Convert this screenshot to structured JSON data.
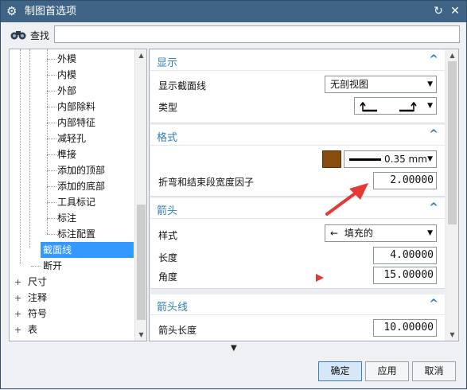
{
  "window": {
    "title": "制图首选项",
    "reset_icon": "reset-icon",
    "close_icon": "close-icon"
  },
  "search": {
    "label": "查找",
    "value": ""
  },
  "tree": {
    "items": [
      {
        "label": "外模",
        "level": 2
      },
      {
        "label": "内模",
        "level": 2
      },
      {
        "label": "外部",
        "level": 2
      },
      {
        "label": "内部除料",
        "level": 2
      },
      {
        "label": "内部特征",
        "level": 2
      },
      {
        "label": "减轻孔",
        "level": 2
      },
      {
        "label": "榫接",
        "level": 2
      },
      {
        "label": "添加的顶部",
        "level": 2
      },
      {
        "label": "添加的底部",
        "level": 2
      },
      {
        "label": "工具标记",
        "level": 2
      },
      {
        "label": "标注",
        "level": 2
      },
      {
        "label": "标注配置",
        "level": 2
      },
      {
        "label": "截面线",
        "level": 1,
        "selected": true
      },
      {
        "label": "断开",
        "level": 1
      },
      {
        "label": "尺寸",
        "level": 0,
        "expandable": true
      },
      {
        "label": "注释",
        "level": 0,
        "expandable": true
      },
      {
        "label": "符号",
        "level": 0,
        "expandable": true
      },
      {
        "label": "表",
        "level": 0,
        "expandable": true
      }
    ]
  },
  "display_section": {
    "title": "显示",
    "show_section_line_label": "显示截面线",
    "show_section_line_value": "无剖视图",
    "type_label": "类型"
  },
  "format_section": {
    "title": "格式",
    "color": "#8a4b0e",
    "line_width": "0.35 mm",
    "bend_factor_label": "折弯和结束段宽度因子",
    "bend_factor_value": "2.00000"
  },
  "arrowhead_section": {
    "title": "箭头",
    "style_label": "样式",
    "style_value": "填充的",
    "length_label": "长度",
    "length_value": "4.00000",
    "angle_label": "角度",
    "angle_value": "15.00000"
  },
  "arrow_line_section": {
    "title": "箭头线",
    "arrow_length_label": "箭头长度",
    "arrow_length_value": "10.00000"
  },
  "buttons": {
    "ok": "确定",
    "apply": "应用",
    "cancel": "取消"
  },
  "colors": {
    "title_bar": "#3f6485",
    "accent": "#2f7fb5",
    "selection": "#3399ff",
    "annotation": "#e53935"
  }
}
